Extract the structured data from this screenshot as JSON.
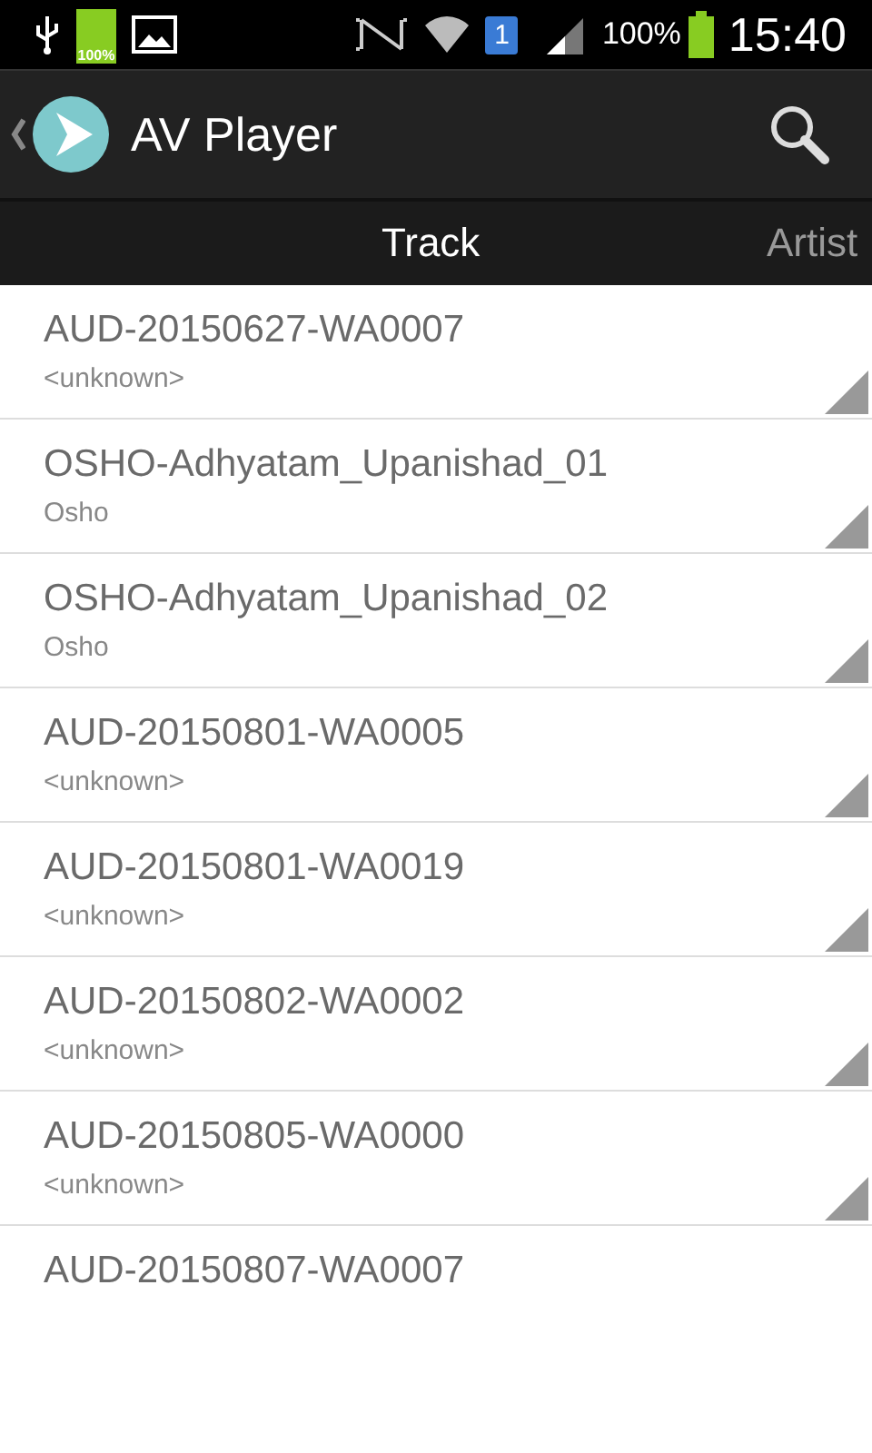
{
  "status_bar": {
    "battery_icon_label": "100%",
    "sim_badge": "1",
    "battery_percent": "100%",
    "time": "15:40"
  },
  "app_bar": {
    "title": "AV Player"
  },
  "tabs": [
    {
      "label": "Track",
      "selected": true
    },
    {
      "label": "Artist",
      "selected": false
    }
  ],
  "tracks": [
    {
      "title": "AUD-20150627-WA0007",
      "artist": "<unknown>"
    },
    {
      "title": "OSHO-Adhyatam_Upanishad_01",
      "artist": "Osho"
    },
    {
      "title": "OSHO-Adhyatam_Upanishad_02",
      "artist": "Osho"
    },
    {
      "title": "AUD-20150801-WA0005",
      "artist": "<unknown>"
    },
    {
      "title": "AUD-20150801-WA0019",
      "artist": "<unknown>"
    },
    {
      "title": "AUD-20150802-WA0002",
      "artist": "<unknown>"
    },
    {
      "title": "AUD-20150805-WA0000",
      "artist": "<unknown>"
    },
    {
      "title": "AUD-20150807-WA0007"
    }
  ]
}
